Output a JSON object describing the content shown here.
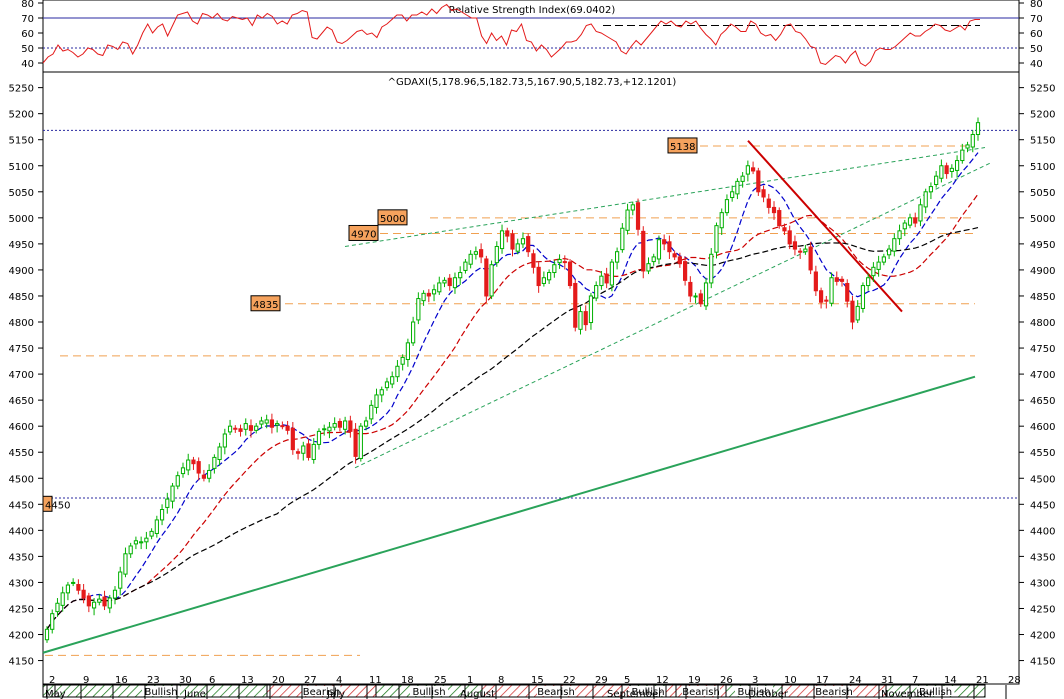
{
  "rsi_panel": {
    "title": "Relative Strength Index(69.0402)",
    "yticks": [
      80,
      70,
      60,
      50,
      40
    ],
    "ylim": [
      34,
      82
    ],
    "levels": {
      "overbought": 70,
      "midline": 50,
      "ref_dashed": 65
    },
    "values": [
      40,
      44,
      46,
      52,
      48,
      49,
      47,
      44,
      46,
      50,
      49,
      46,
      45,
      52,
      51,
      49,
      54,
      53,
      46,
      52,
      60,
      66,
      60,
      64,
      66,
      58,
      65,
      72,
      73,
      74,
      68,
      66,
      73,
      72,
      70,
      73,
      69,
      68,
      71,
      70,
      69,
      70,
      65,
      72,
      70,
      73,
      71,
      66,
      68,
      66,
      72,
      73,
      75,
      74,
      57,
      56,
      60,
      64,
      62,
      54,
      53,
      55,
      58,
      61,
      62,
      59,
      60,
      57,
      64,
      66,
      69,
      72,
      72,
      68,
      72,
      72,
      74,
      72,
      76,
      73,
      77,
      79,
      75,
      76,
      74,
      72,
      70,
      70,
      58,
      53,
      60,
      55,
      58,
      52,
      62,
      61,
      66,
      55,
      54,
      48,
      52,
      49,
      44,
      47,
      50,
      54,
      54,
      55,
      59,
      65,
      66,
      61,
      60,
      58,
      56,
      54,
      48,
      46,
      51,
      55,
      52,
      56,
      60,
      64,
      68,
      66,
      68,
      65,
      64,
      68,
      66,
      68,
      63,
      59,
      56,
      52,
      59,
      62,
      66,
      64,
      61,
      61,
      68,
      66,
      60,
      58,
      59,
      55,
      59,
      65,
      66,
      61,
      60,
      56,
      51,
      50,
      40,
      39,
      42,
      45,
      44,
      40,
      45,
      48,
      40,
      38,
      41,
      48,
      50,
      49,
      49,
      51,
      54,
      57,
      60,
      58,
      58,
      61,
      63,
      66,
      65,
      62,
      61,
      63,
      65,
      62,
      68,
      69,
      69
    ]
  },
  "price_panel": {
    "header": "^GDAXI(5,178.96,5,182.73,5,167.90,5,182.73,+12.1201)",
    "yticks": [
      5250,
      5200,
      5150,
      5100,
      5050,
      5000,
      4950,
      4900,
      4850,
      4800,
      4750,
      4700,
      4650,
      4600,
      4550,
      4500,
      4450,
      4400,
      4350,
      4300,
      4250,
      4200,
      4150
    ],
    "ylim": [
      4105,
      5280
    ],
    "level_labels": [
      {
        "label": "5138",
        "value": 5138
      },
      {
        "label": "5000",
        "value": 5000
      },
      {
        "label": "4970",
        "value": 4970
      },
      {
        "label": "4835",
        "value": 4835
      },
      {
        "label": "4450",
        "value": 4450
      }
    ],
    "hlines": [
      {
        "value": 5168,
        "style": "blue-dotted"
      },
      {
        "value": 5138,
        "style": "orange-dashed"
      },
      {
        "value": 5000,
        "style": "orange-dashed"
      },
      {
        "value": 4970,
        "style": "orange-dashed"
      },
      {
        "value": 4835,
        "style": "orange-dashed"
      },
      {
        "value": 4735,
        "style": "orange-dashed"
      },
      {
        "value": 4462,
        "style": "blue-dotted"
      },
      {
        "value": 4160,
        "style": "orange-dashed"
      }
    ],
    "date_row": [
      "May",
      "2",
      "9",
      "16",
      "23",
      "30",
      "June",
      "6",
      "13",
      "20",
      "27",
      "July",
      "4",
      "11",
      "18",
      "25",
      "August",
      "1",
      "8",
      "15",
      "22",
      "29",
      "September",
      "5",
      "12",
      "19",
      "26",
      "October",
      "3",
      "10",
      "17",
      "24",
      "31",
      "November",
      "7",
      "14",
      "21",
      "28"
    ],
    "trend_bar": [
      "Bullish",
      "Bearish",
      "Bullish",
      "Bearish",
      "Bullish",
      "Bearish",
      "Bullish",
      "Bearish",
      "Bullish"
    ]
  },
  "chart_data": [
    {
      "type": "line",
      "title": "Relative Strength Index(69.0402)",
      "yticks": [
        80,
        70,
        60,
        50,
        40
      ],
      "series": []
    },
    {
      "type": "candlestick",
      "title": "^GDAXI(5,178.96,5,182.73,5,167.90,5,182.73,+12.1201)",
      "closes": [
        4210,
        4240,
        4260,
        4280,
        4295,
        4300,
        4285,
        4270,
        4255,
        4262,
        4268,
        4255,
        4270,
        4285,
        4320,
        4355,
        4370,
        4380,
        4378,
        4385,
        4398,
        4420,
        4440,
        4460,
        4485,
        4505,
        4520,
        4535,
        4528,
        4510,
        4500,
        4515,
        4540,
        4560,
        4585,
        4600,
        4595,
        4590,
        4605,
        4592,
        4600,
        4610,
        4612,
        4598,
        4605,
        4600,
        4592,
        4555,
        4548,
        4562,
        4540,
        4565,
        4590,
        4595,
        4598,
        4605,
        4598,
        4610,
        4590,
        4542,
        4600,
        4610,
        4640,
        4660,
        4670,
        4685,
        4695,
        4715,
        4732,
        4760,
        4800,
        4845,
        4855,
        4850,
        4862,
        4875,
        4880,
        4870,
        4885,
        4895,
        4915,
        4930,
        4935,
        4925,
        4850,
        4910,
        4945,
        4975,
        4965,
        4940,
        4950,
        4960,
        4935,
        4905,
        4870,
        4885,
        4895,
        4910,
        4920,
        4915,
        4870,
        4790,
        4820,
        4795,
        4850,
        4870,
        4888,
        4875,
        4915,
        4935,
        4980,
        5015,
        5025,
        4978,
        4898,
        4912,
        4925,
        4958,
        4950,
        4935,
        4925,
        4912,
        4880,
        4850,
        4850,
        4835,
        4875,
        4930,
        4985,
        5010,
        5035,
        5050,
        5070,
        5080,
        5100,
        5090,
        5050,
        5040,
        5020,
        5010,
        4985,
        4975,
        4950,
        4940,
        4935,
        4940,
        4900,
        4860,
        4838,
        4840,
        4885,
        4878,
        4878,
        4840,
        4800,
        4830,
        4870,
        4885,
        4905,
        4915,
        4925,
        4940,
        4960,
        4975,
        4990,
        5000,
        4990,
        5025,
        5050,
        5060,
        5080,
        5100,
        5085,
        5095,
        5110,
        5130,
        5140,
        5160,
        5182.73
      ],
      "ylim": [
        4105,
        5280
      ]
    }
  ],
  "colors": {
    "rsi_line": "#e41b1b",
    "up_candle": "#00b000",
    "down_candle": "#e41b1b",
    "ma_short": "#0000cc",
    "ma_mid": "#cc0000",
    "ma_long": "#000000",
    "trend_green": "#2aa35a",
    "level_orange": "#f0a050",
    "level_box": "#f5a25d",
    "dotted_blue": "#2a2aa0",
    "bullish_hatch": "#1c7a1c",
    "bearish_hatch": "#d03030"
  }
}
